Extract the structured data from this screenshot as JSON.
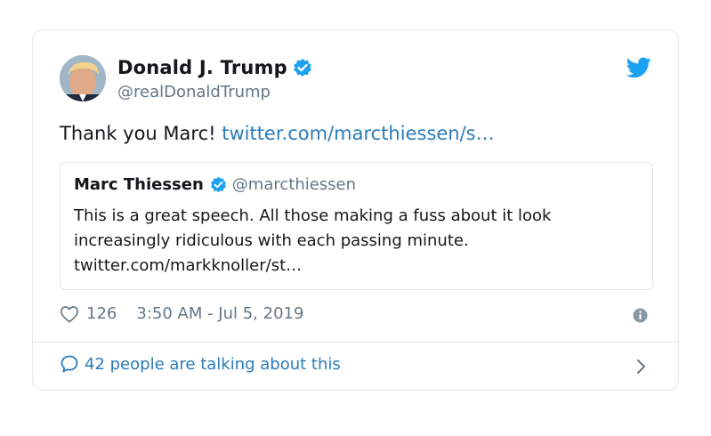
{
  "tweet": {
    "author_name": "Donald J. Trump",
    "author_handle": "@realDonaldTrump",
    "text": "Thank you Marc! ",
    "link": "twitter.com/marcthiessen/s…",
    "likes": "126",
    "timestamp": "3:50 AM - Jul 5, 2019",
    "talking": "42 people are talking about this"
  },
  "quote": {
    "author_name": "Marc Thiessen",
    "author_handle": "@marcthiessen",
    "text_line1": "This is a great speech. All those making a fuss about it look",
    "text_line2": "increasingly ridiculous with each passing minute.",
    "text_line3": "twitter.com/markknoller/st…"
  },
  "colors": {
    "accent": "#1da1f2",
    "link": "#2b7bb9",
    "muted": "#657786",
    "border": "#e1e8ed"
  },
  "icons": [
    "verified-badge-icon",
    "twitter-bird-icon",
    "heart-icon",
    "info-icon",
    "speech-bubble-icon",
    "chevron-right-icon"
  ]
}
